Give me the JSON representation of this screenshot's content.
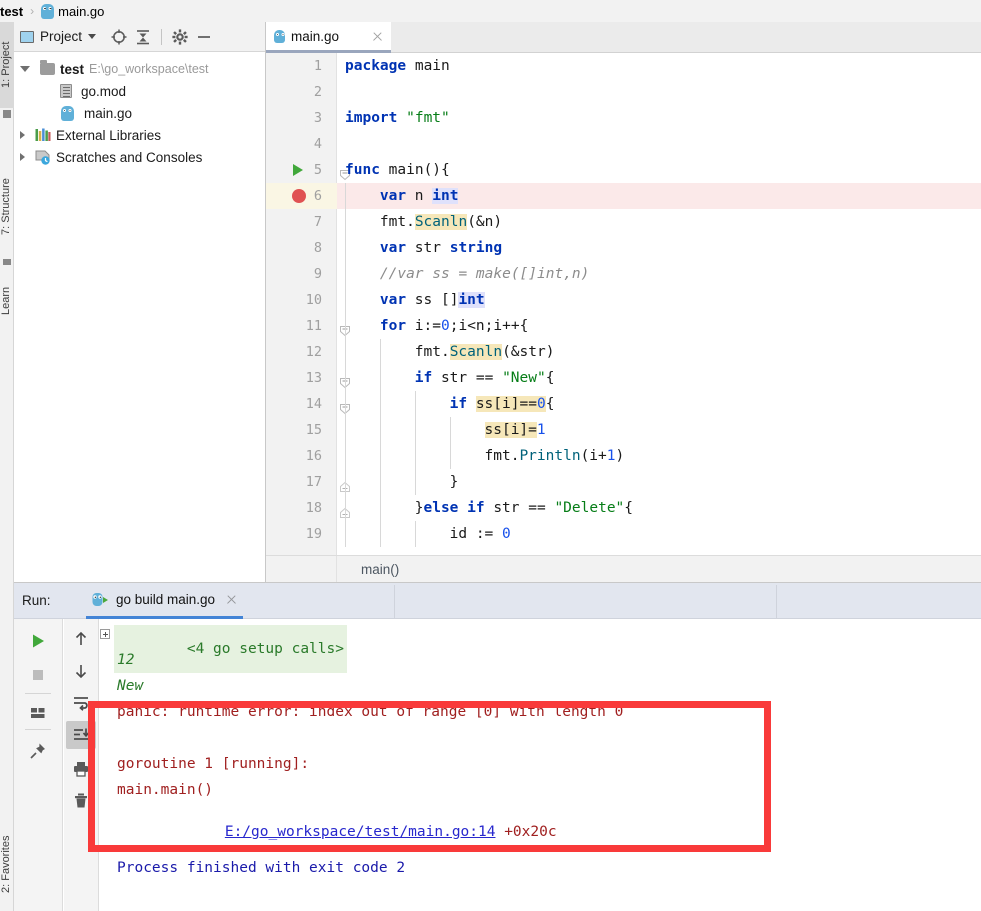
{
  "breadcrumb": {
    "project": "test",
    "separator": "›",
    "file": "main.go",
    "file_icon": "go-gopher-icon"
  },
  "left_strip": {
    "items": [
      {
        "label": "1: Project",
        "selected": true
      },
      {
        "label": "7: Structure",
        "selected": false
      },
      {
        "label": "Learn",
        "selected": false
      },
      {
        "label": "2: Favorites",
        "selected": false
      }
    ]
  },
  "project_panel": {
    "title": "Project",
    "icons": [
      "project-view-icon",
      "chevron-down-icon",
      "locate-icon",
      "collapse-all-icon",
      "gear-icon",
      "hide-icon"
    ],
    "tree": [
      {
        "label": "test",
        "path": "E:\\go_workspace\\test",
        "icon": "folder-icon",
        "expanded": true,
        "bold": true,
        "indent": 0
      },
      {
        "label": "go.mod",
        "path": "",
        "icon": "mod-file-icon",
        "expanded": null,
        "bold": false,
        "indent": 1
      },
      {
        "label": "main.go",
        "path": "",
        "icon": "go-gopher-icon",
        "expanded": null,
        "bold": false,
        "indent": 1
      },
      {
        "label": "External Libraries",
        "path": "",
        "icon": "library-icon",
        "expanded": false,
        "bold": false,
        "indent": 0
      },
      {
        "label": "Scratches and Consoles",
        "path": "",
        "icon": "scratches-icon",
        "expanded": false,
        "bold": false,
        "indent": 0
      }
    ]
  },
  "editor": {
    "tab": {
      "label": "main.go",
      "icon": "go-gopher-icon",
      "close": "close-icon"
    },
    "status_text": "main()",
    "lines": [
      {
        "num": "1",
        "indent": 0,
        "marker": "",
        "fold": "",
        "tokens": [
          {
            "t": "package ",
            "c": "kw"
          },
          {
            "t": "main",
            "c": "plain"
          }
        ]
      },
      {
        "num": "2",
        "indent": 0,
        "marker": "",
        "fold": "",
        "tokens": []
      },
      {
        "num": "3",
        "indent": 0,
        "marker": "",
        "fold": "",
        "tokens": [
          {
            "t": "import ",
            "c": "kw"
          },
          {
            "t": "\"fmt\"",
            "c": "str"
          }
        ]
      },
      {
        "num": "4",
        "indent": 0,
        "marker": "",
        "fold": "",
        "tokens": []
      },
      {
        "num": "5",
        "indent": 0,
        "marker": "run",
        "fold": "open",
        "tokens": [
          {
            "t": "func ",
            "c": "kw"
          },
          {
            "t": "main",
            "c": "plain"
          },
          {
            "t": "(){",
            "c": "plain"
          }
        ]
      },
      {
        "num": "6",
        "indent": 1,
        "marker": "breakpoint",
        "fold": "",
        "highlight": "#fbe9e9",
        "tokens": [
          {
            "t": "var ",
            "c": "kw"
          },
          {
            "t": "n ",
            "c": "plain"
          },
          {
            "t": "int",
            "c": "typ hl-type"
          }
        ]
      },
      {
        "num": "7",
        "indent": 1,
        "marker": "",
        "fold": "",
        "tokens": [
          {
            "t": "fmt",
            "c": "plain"
          },
          {
            "t": ".",
            "c": "plain"
          },
          {
            "t": "Scanln",
            "c": "fn hl-ident"
          },
          {
            "t": "(&n)",
            "c": "plain"
          }
        ]
      },
      {
        "num": "8",
        "indent": 1,
        "marker": "",
        "fold": "",
        "tokens": [
          {
            "t": "var ",
            "c": "kw"
          },
          {
            "t": "str ",
            "c": "plain"
          },
          {
            "t": "string",
            "c": "typ"
          }
        ]
      },
      {
        "num": "9",
        "indent": 1,
        "marker": "",
        "fold": "",
        "tokens": [
          {
            "t": "//var ss = make([]int,n)",
            "c": "cmt"
          }
        ]
      },
      {
        "num": "10",
        "indent": 1,
        "marker": "",
        "fold": "",
        "tokens": [
          {
            "t": "var ",
            "c": "kw"
          },
          {
            "t": "ss []",
            "c": "plain"
          },
          {
            "t": "int",
            "c": "typ hl-type"
          }
        ]
      },
      {
        "num": "11",
        "indent": 1,
        "marker": "",
        "fold": "open",
        "tokens": [
          {
            "t": "for ",
            "c": "kw"
          },
          {
            "t": "i:=",
            "c": "plain"
          },
          {
            "t": "0",
            "c": "num"
          },
          {
            "t": ";i<n;i++{",
            "c": "plain"
          }
        ]
      },
      {
        "num": "12",
        "indent": 2,
        "marker": "",
        "fold": "",
        "tokens": [
          {
            "t": "fmt",
            "c": "plain"
          },
          {
            "t": ".",
            "c": "plain"
          },
          {
            "t": "Scanln",
            "c": "fn hl-ident"
          },
          {
            "t": "(&str)",
            "c": "plain"
          }
        ]
      },
      {
        "num": "13",
        "indent": 2,
        "marker": "",
        "fold": "open",
        "tokens": [
          {
            "t": "if ",
            "c": "kw"
          },
          {
            "t": "str == ",
            "c": "plain"
          },
          {
            "t": "\"New\"",
            "c": "str"
          },
          {
            "t": "{",
            "c": "plain"
          }
        ]
      },
      {
        "num": "14",
        "indent": 3,
        "marker": "",
        "fold": "open",
        "tokens": [
          {
            "t": "if ",
            "c": "kw"
          },
          {
            "t": "ss[i]",
            "c": "plain hl-ident"
          },
          {
            "t": "==",
            "c": "plain hl-ident"
          },
          {
            "t": "0",
            "c": "num hl-ident"
          },
          {
            "t": "{",
            "c": "plain"
          }
        ]
      },
      {
        "num": "15",
        "indent": 4,
        "marker": "",
        "fold": "",
        "tokens": [
          {
            "t": "ss[i]",
            "c": "plain hl-ident"
          },
          {
            "t": "=",
            "c": "plain hl-ident"
          },
          {
            "t": "1",
            "c": "num"
          }
        ]
      },
      {
        "num": "16",
        "indent": 4,
        "marker": "",
        "fold": "",
        "tokens": [
          {
            "t": "fmt",
            "c": "plain"
          },
          {
            "t": ".",
            "c": "plain"
          },
          {
            "t": "Println",
            "c": "fn"
          },
          {
            "t": "(i+",
            "c": "plain"
          },
          {
            "t": "1",
            "c": "num"
          },
          {
            "t": ")",
            "c": "plain"
          }
        ]
      },
      {
        "num": "17",
        "indent": 3,
        "marker": "",
        "fold": "close",
        "tokens": [
          {
            "t": "}",
            "c": "plain"
          }
        ]
      },
      {
        "num": "18",
        "indent": 2,
        "marker": "",
        "fold": "close",
        "tokens": [
          {
            "t": "}",
            "c": "plain"
          },
          {
            "t": "else if ",
            "c": "kw"
          },
          {
            "t": "str == ",
            "c": "plain"
          },
          {
            "t": "\"Delete\"",
            "c": "str"
          },
          {
            "t": "{",
            "c": "plain"
          }
        ]
      },
      {
        "num": "19",
        "indent": 3,
        "marker": "",
        "fold": "",
        "tokens": [
          {
            "t": "id := ",
            "c": "plain"
          },
          {
            "t": "0",
            "c": "num"
          }
        ]
      }
    ]
  },
  "run_window": {
    "label": "Run:",
    "tab": {
      "label": "go build main.go",
      "icon": "go-run-icon",
      "close": "close-icon"
    },
    "left_buttons": [
      {
        "name": "rerun-button",
        "icon": "play-icon"
      },
      {
        "name": "stop-button",
        "icon": "stop-icon"
      },
      {
        "name": "layout-button",
        "icon": "layout-icon"
      },
      {
        "name": "pin-tab-button",
        "icon": "pin-icon"
      }
    ],
    "right_buttons": [
      {
        "name": "prev-occurrence-button",
        "icon": "arrow-up-icon"
      },
      {
        "name": "next-occurrence-button",
        "icon": "arrow-down-icon"
      },
      {
        "name": "soft-wrap-button",
        "icon": "soft-wrap-icon"
      },
      {
        "name": "scroll-to-end-button",
        "icon": "scroll-to-end-icon",
        "active": true
      },
      {
        "name": "print-button",
        "icon": "printer-icon"
      },
      {
        "name": "clear-all-button",
        "icon": "trash-icon"
      }
    ],
    "console": [
      {
        "text": "<4 go setup calls>",
        "style": "collapsed-header",
        "expander": true
      },
      {
        "text": "12",
        "style": "stdout-italic"
      },
      {
        "text": "New",
        "style": "stdout-italic"
      },
      {
        "text": "panic: runtime error: index out of range [0] with length 0",
        "style": "stderr"
      },
      {
        "text": "",
        "style": "stderr"
      },
      {
        "text": "goroutine 1 [running]:",
        "style": "stderr"
      },
      {
        "text": "main.main()",
        "style": "stderr"
      },
      {
        "text": "\tE:/go_workspace/test/main.go:14",
        "style": "stderr-link",
        "suffix": " +0x20c"
      },
      {
        "text": "Process finished with exit code 2",
        "style": "info"
      }
    ],
    "annotation": {
      "name": "error-highlight-box",
      "color": "#f93a3a"
    }
  },
  "colors": {
    "keyword": "#0033b3",
    "string": "#067d17",
    "number": "#1750eb",
    "comment": "#8c8c8c",
    "error_box": "#f93a3a",
    "breakpoint": "#e05252",
    "run_tab_underline": "#4384d6",
    "console_stderr": "#a02020",
    "console_stdout": "#2a7a2a",
    "console_info": "#1a1aaa",
    "line_highlight": "#fbe9e9"
  }
}
